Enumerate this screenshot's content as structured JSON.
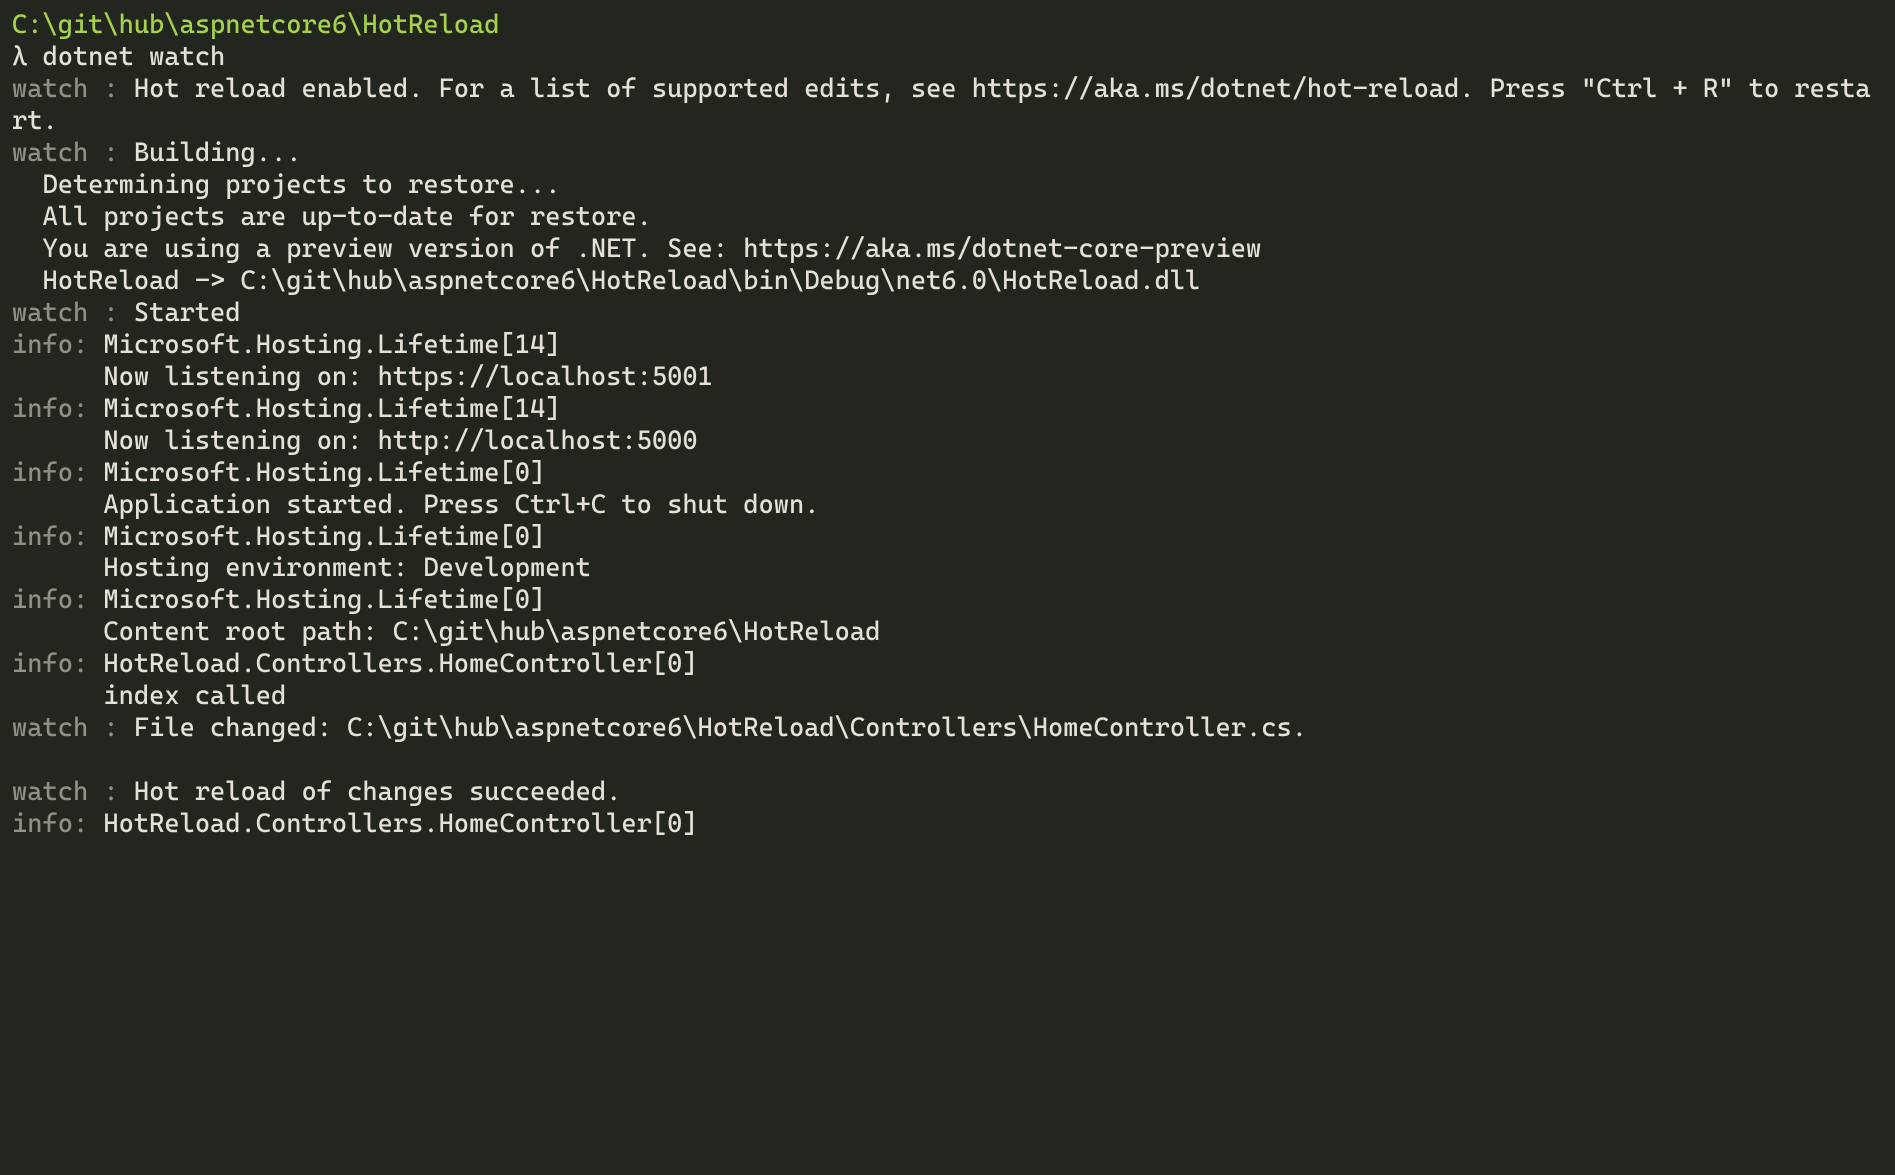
{
  "cwd": "C:\\git\\hub\\aspnetcore6\\HotReload",
  "prompt_symbol": "λ ",
  "command": "dotnet watch",
  "lines": [
    {
      "prefix": "watch : ",
      "text": "Hot reload enabled. For a list of supported edits, see https://aka.ms/dotnet/hot-reload. Press \"Ctrl + R\" to restart."
    },
    {
      "prefix": "watch : ",
      "text": "Building..."
    },
    {
      "prefix": "",
      "text": "  Determining projects to restore..."
    },
    {
      "prefix": "",
      "text": "  All projects are up-to-date for restore."
    },
    {
      "prefix": "",
      "text": "  You are using a preview version of .NET. See: https://aka.ms/dotnet-core-preview"
    },
    {
      "prefix": "",
      "text": "  HotReload -> C:\\git\\hub\\aspnetcore6\\HotReload\\bin\\Debug\\net6.0\\HotReload.dll"
    },
    {
      "prefix": "watch : ",
      "text": "Started"
    },
    {
      "prefix": "info: ",
      "text": "Microsoft.Hosting.Lifetime[14]"
    },
    {
      "prefix": "",
      "text": "      Now listening on: https://localhost:5001"
    },
    {
      "prefix": "info: ",
      "text": "Microsoft.Hosting.Lifetime[14]"
    },
    {
      "prefix": "",
      "text": "      Now listening on: http://localhost:5000"
    },
    {
      "prefix": "info: ",
      "text": "Microsoft.Hosting.Lifetime[0]"
    },
    {
      "prefix": "",
      "text": "      Application started. Press Ctrl+C to shut down."
    },
    {
      "prefix": "info: ",
      "text": "Microsoft.Hosting.Lifetime[0]"
    },
    {
      "prefix": "",
      "text": "      Hosting environment: Development"
    },
    {
      "prefix": "info: ",
      "text": "Microsoft.Hosting.Lifetime[0]"
    },
    {
      "prefix": "",
      "text": "      Content root path: C:\\git\\hub\\aspnetcore6\\HotReload"
    },
    {
      "prefix": "info: ",
      "text": "HotReload.Controllers.HomeController[0]"
    },
    {
      "prefix": "",
      "text": "      index called"
    },
    {
      "prefix": "watch : ",
      "text": "File changed: C:\\git\\hub\\aspnetcore6\\HotReload\\Controllers\\HomeController.cs."
    },
    {
      "prefix": "",
      "text": ""
    },
    {
      "prefix": "watch : ",
      "text": "Hot reload of changes succeeded."
    },
    {
      "prefix": "info: ",
      "text": "HotReload.Controllers.HomeController[0]"
    }
  ]
}
